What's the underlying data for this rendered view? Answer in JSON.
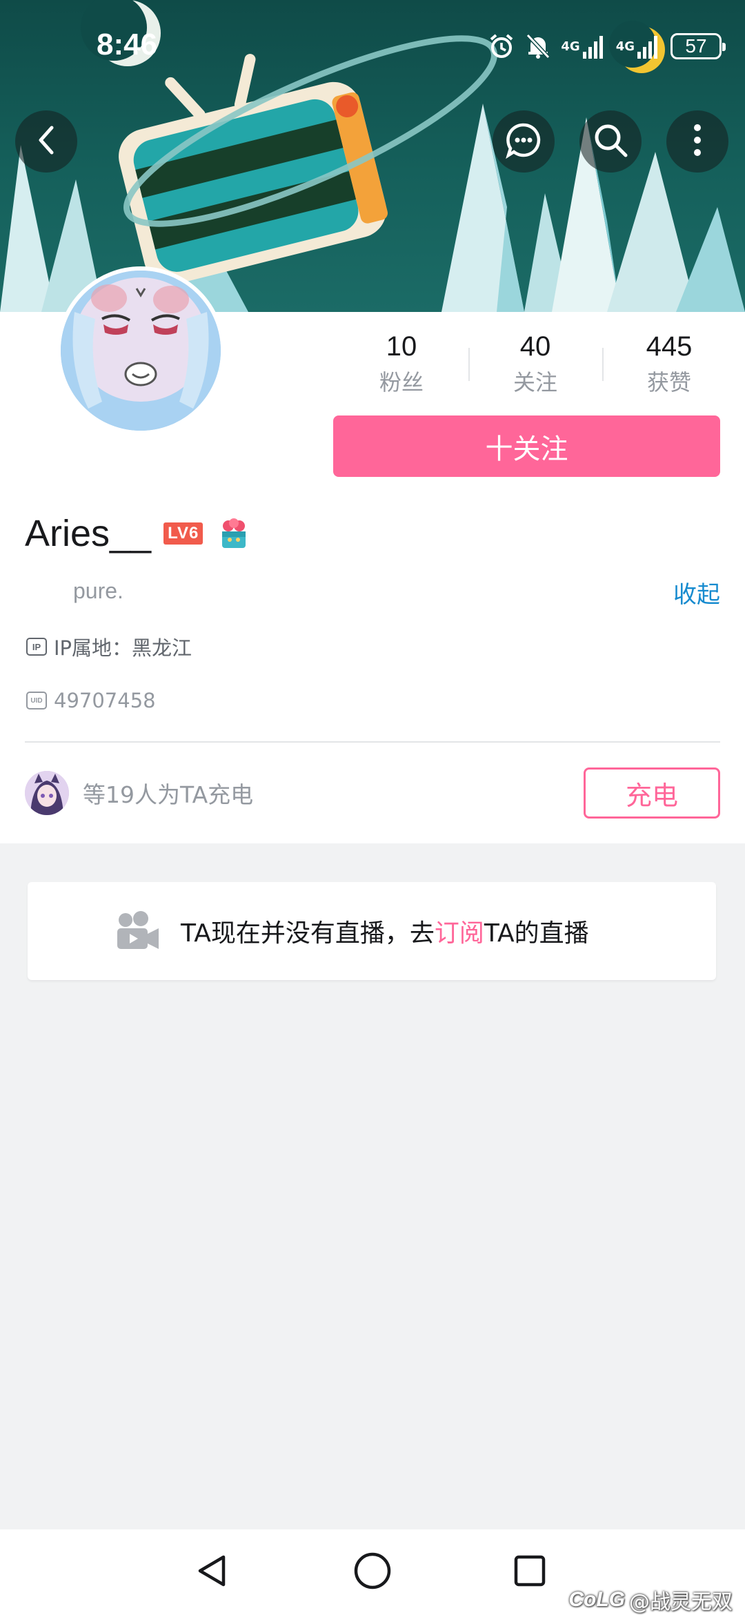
{
  "status_bar": {
    "time": "8:46",
    "network_1": "4G",
    "network_2": "4G",
    "battery": "57"
  },
  "header": {
    "back_icon": "chevron-left-icon",
    "message_icon": "chat-bubble-icon",
    "search_icon": "search-icon",
    "more_icon": "more-vertical-icon"
  },
  "stats": [
    {
      "value": "10",
      "label": "粉丝"
    },
    {
      "value": "40",
      "label": "关注"
    },
    {
      "value": "445",
      "label": "获赞"
    }
  ],
  "follow_button": {
    "label": "十关注"
  },
  "user": {
    "name": "Aries__",
    "level_badge": "LV6",
    "signature": "pure.",
    "collapse_label": "收起",
    "ip_tag": "IP",
    "ip_location": "IP属地：黑龙江",
    "uid_tag": "UID",
    "uid": "49707458"
  },
  "charge": {
    "text": "等19人为TA充电",
    "button_label": "充电"
  },
  "live": {
    "text_before": "TA现在并没有直播，去",
    "link_text": "订阅",
    "text_after": "TA的直播"
  },
  "watermark": {
    "logo": "CoLG",
    "text": "@战灵无双"
  },
  "colors": {
    "accent_pink": "#ff6699",
    "link_blue": "#178bcf",
    "level_red": "#f15b4c",
    "page_bg": "#f1f2f3"
  }
}
